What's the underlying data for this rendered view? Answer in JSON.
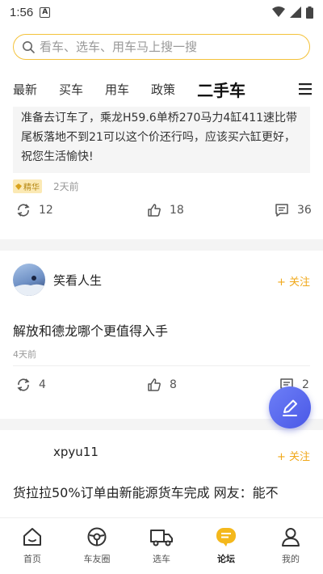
{
  "status_bar": {
    "time": "1:56",
    "notice_letter": "A"
  },
  "search": {
    "placeholder": "看车、选车、用车马上搜一搜"
  },
  "tabs": [
    {
      "label": "最新"
    },
    {
      "label": "买车"
    },
    {
      "label": "用车"
    },
    {
      "label": "政策"
    },
    {
      "label": "二手车",
      "active": true
    }
  ],
  "posts": [
    {
      "quote": "准备去订车了，乘龙H59.6单桥270马力4缸411速比带尾板落地不到21可以这个价还行吗，应该买六缸更好，祝您生活愉快!",
      "badge": "精华",
      "time": "2天前",
      "shares": "12",
      "likes": "18",
      "comments": "36"
    },
    {
      "username": "笑看人生",
      "follow": "+ 关注",
      "title": "解放和德龙哪个更值得入手",
      "time": "4天前",
      "shares": "4",
      "likes": "8",
      "comments": "2"
    },
    {
      "username": "xpyu11",
      "follow": "+ 关注",
      "title": "货拉拉50%订单由新能源货车完成 网友：能不"
    }
  ],
  "bottom_nav": [
    {
      "label": "首页",
      "icon": "home-icon"
    },
    {
      "label": "车友圈",
      "icon": "circle-icon"
    },
    {
      "label": "选车",
      "icon": "truck-icon"
    },
    {
      "label": "论坛",
      "icon": "forum-icon",
      "active": true
    },
    {
      "label": "我的",
      "icon": "profile-icon"
    }
  ],
  "colors": {
    "accent": "#f4c23a",
    "follow": "#f0a81a",
    "fab": "#5b6cf0"
  }
}
